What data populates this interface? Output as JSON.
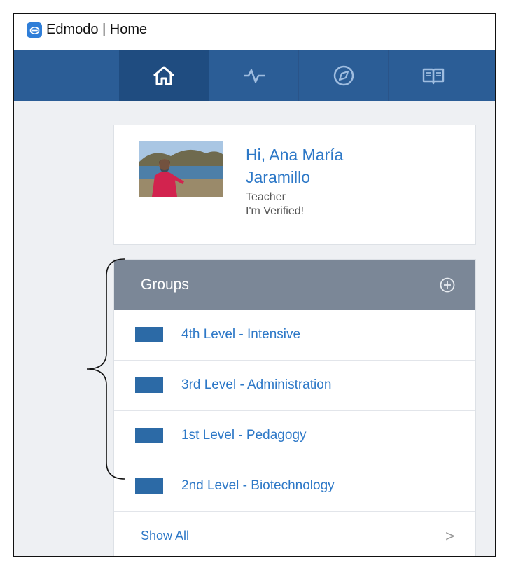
{
  "window": {
    "title": "Edmodo | Home"
  },
  "nav": {
    "tabs": [
      {
        "name": "home",
        "icon": "home-icon",
        "active": true
      },
      {
        "name": "activity",
        "icon": "pulse-icon",
        "active": false
      },
      {
        "name": "discover",
        "icon": "compass-icon",
        "active": false
      },
      {
        "name": "library",
        "icon": "book-icon",
        "active": false
      }
    ]
  },
  "profile": {
    "greeting_line1": "Hi, Ana María",
    "greeting_line2": "Jaramillo",
    "role": "Teacher",
    "verified": "I'm Verified!"
  },
  "groups": {
    "title": "Groups",
    "items": [
      {
        "label": "4th Level - Intensive"
      },
      {
        "label": "3rd Level - Administration"
      },
      {
        "label": "1st Level - Pedagogy"
      },
      {
        "label": "2nd Level - Biotechnology"
      }
    ],
    "show_all": "Show All"
  },
  "colors": {
    "nav_bar": "#2b5d96",
    "accent_link": "#2d78c7",
    "group_swatch": "#2c6aa6",
    "groups_header": "#7b8797"
  }
}
